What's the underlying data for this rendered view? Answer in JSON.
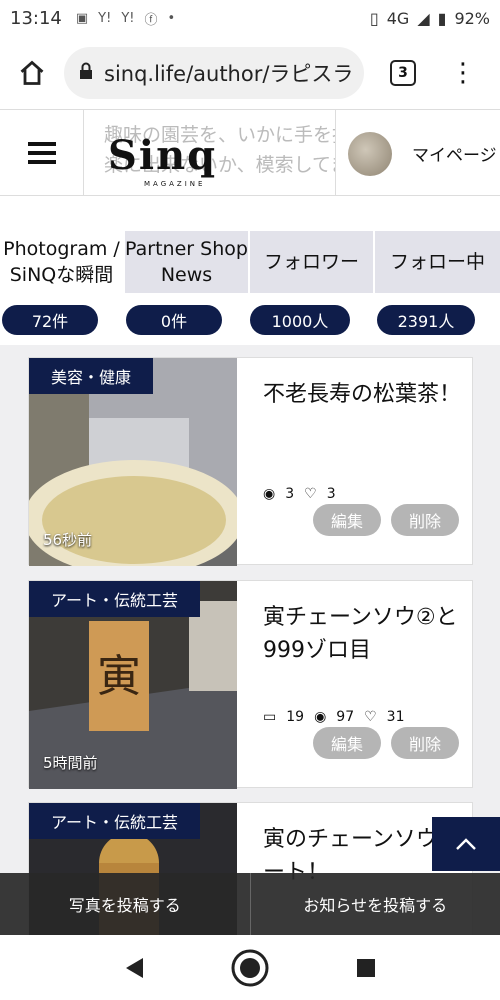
{
  "status_bar": {
    "time": "13:14",
    "battery": "92%",
    "network": "4G"
  },
  "browser": {
    "url": "sinq.life/author/ラピスラ",
    "tab_count": "3"
  },
  "site": {
    "logo_text": "Sinq",
    "logo_sub": "MAGAZINE",
    "tagline": "趣味の園芸を、いかに手を抜いて楽に出来ないか、模索してます。",
    "mypage_label": "マイページ"
  },
  "profile_tabs": [
    {
      "label1": "Photogram /",
      "label2": "SiNQな瞬間",
      "count": "72件"
    },
    {
      "label1": "Partner Shop",
      "label2": "News",
      "count": "0件"
    },
    {
      "label1": "フォロワー",
      "label2": "",
      "count": "1000人"
    },
    {
      "label1": "フォロー中",
      "label2": "",
      "count": "2391人"
    }
  ],
  "posts": [
    {
      "category": "美容・健康",
      "title": "不老長寿の松葉茶！",
      "ago": "56秒前",
      "comments": "",
      "views": "3",
      "likes": "3",
      "edit_label": "編集",
      "delete_label": "削除"
    },
    {
      "category": "アート・伝統工芸",
      "title": "寅チェーンソウ②と999ゾロ目",
      "ago": "5時間前",
      "comments": "19",
      "views": "97",
      "likes": "31",
      "edit_label": "編集",
      "delete_label": "削除"
    },
    {
      "category": "アート・伝統工芸",
      "title": "寅のチェーンソウアート！",
      "ago": "",
      "comments": "",
      "views": "",
      "likes": "",
      "edit_label": "",
      "delete_label": ""
    }
  ],
  "bottom_actions": {
    "post_photo": "写真を投稿する",
    "post_news": "お知らせを投稿する"
  },
  "colors": {
    "navy": "#0f1d4a",
    "tab_bg": "#e2e2ea",
    "button_gray": "#b5b5b5"
  }
}
